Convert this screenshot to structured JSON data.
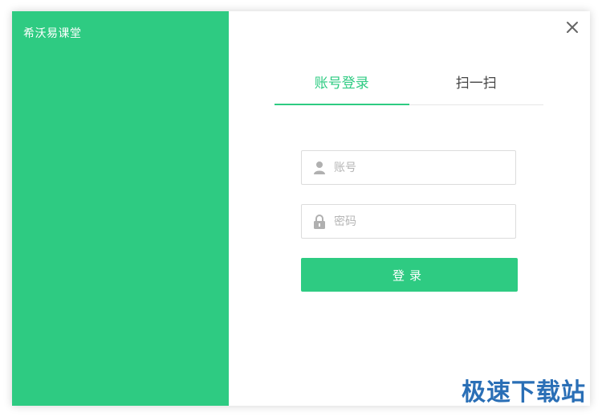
{
  "window": {
    "app_title": "希沃易课堂",
    "accent_color": "#2ecb82",
    "close_icon": "close-icon"
  },
  "login": {
    "tabs": [
      {
        "label": "账号登录",
        "active": true
      },
      {
        "label": "扫一扫",
        "active": false
      }
    ],
    "account_field": {
      "value": "",
      "placeholder": "账号",
      "icon": "user-icon"
    },
    "password_field": {
      "value": "",
      "placeholder": "密码",
      "icon": "lock-icon"
    },
    "submit_label": "登录"
  },
  "watermark": {
    "text": "极速下载站"
  }
}
